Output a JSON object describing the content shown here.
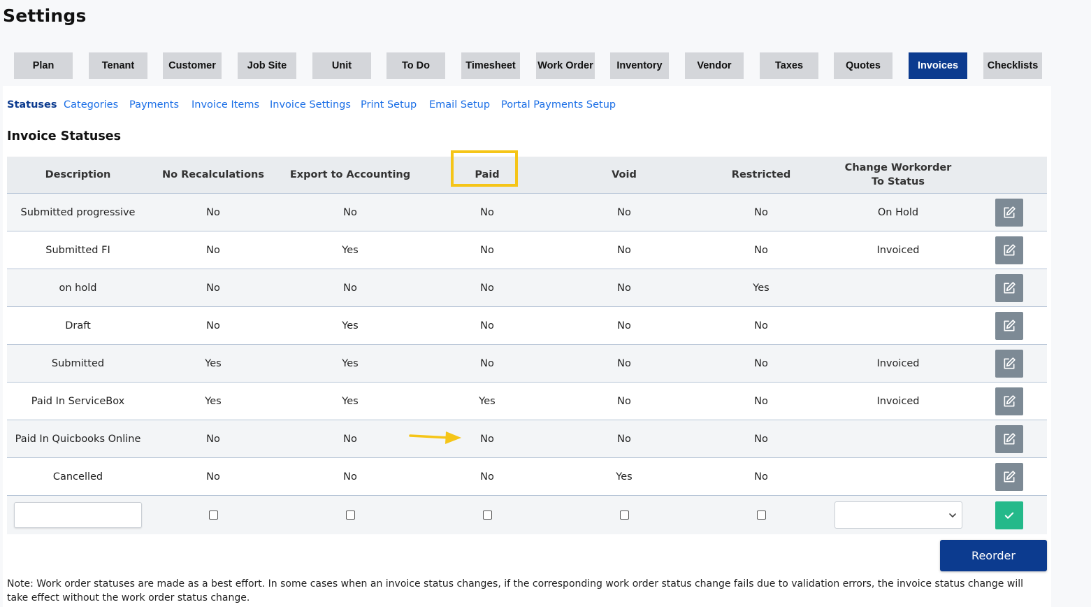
{
  "page": {
    "title": "Settings"
  },
  "top_tabs": [
    {
      "label": "Plan",
      "active": false
    },
    {
      "label": "Tenant",
      "active": false
    },
    {
      "label": "Customer",
      "active": false
    },
    {
      "label": "Job Site",
      "active": false
    },
    {
      "label": "Unit",
      "active": false
    },
    {
      "label": "To Do",
      "active": false
    },
    {
      "label": "Timesheet",
      "active": false
    },
    {
      "label": "Work Order",
      "active": false
    },
    {
      "label": "Inventory",
      "active": false
    },
    {
      "label": "Vendor",
      "active": false
    },
    {
      "label": "Taxes",
      "active": false
    },
    {
      "label": "Quotes",
      "active": false
    },
    {
      "label": "Invoices",
      "active": true
    },
    {
      "label": "Checklists",
      "active": false
    }
  ],
  "sub_tabs": [
    {
      "label": "Statuses",
      "active": true
    },
    {
      "label": "Categories",
      "active": false
    },
    {
      "label": "Payments",
      "active": false
    },
    {
      "label": "Invoice Items",
      "active": false
    },
    {
      "label": "Invoice Settings",
      "active": false
    },
    {
      "label": "Print Setup",
      "active": false
    },
    {
      "label": "Email Setup",
      "active": false
    },
    {
      "label": "Portal Payments Setup",
      "active": false
    }
  ],
  "section": {
    "title": "Invoice Statuses"
  },
  "table": {
    "headers": {
      "description": "Description",
      "no_recalculations": "No Recalculations",
      "export_to_accounting": "Export to Accounting",
      "paid": "Paid",
      "void": "Void",
      "restricted": "Restricted",
      "change_workorder_line1": "Change Workorder",
      "change_workorder_line2": "To Status"
    },
    "rows": [
      [
        "Submitted progressive",
        "No",
        "No",
        "No",
        "No",
        "No",
        "On Hold"
      ],
      [
        "Submitted FI",
        "No",
        "Yes",
        "No",
        "No",
        "No",
        "Invoiced"
      ],
      [
        "on hold",
        "No",
        "No",
        "No",
        "No",
        "Yes",
        ""
      ],
      [
        "Draft",
        "No",
        "Yes",
        "No",
        "No",
        "No",
        ""
      ],
      [
        "Submitted",
        "Yes",
        "Yes",
        "No",
        "No",
        "No",
        "Invoiced"
      ],
      [
        "Paid In ServiceBox",
        "Yes",
        "Yes",
        "Yes",
        "No",
        "No",
        "Invoiced"
      ],
      [
        "Paid In Quicbooks Online",
        "No",
        "No",
        "No",
        "No",
        "No",
        ""
      ],
      [
        "Cancelled",
        "No",
        "No",
        "No",
        "Yes",
        "No",
        ""
      ]
    ],
    "new_row": {
      "description_value": "",
      "no_recalculations": false,
      "export_to_accounting": false,
      "paid": false,
      "void": false,
      "restricted": false,
      "change_workorder_value": ""
    }
  },
  "buttons": {
    "reorder": "Reorder"
  },
  "note": "Note: Work order statuses are made as a best effort. In some cases when an invoice status changes, if the corresponding work order status change fails due to validation errors, the invoice status change will take effect without the work order status change.",
  "icons": {
    "edit": "edit-icon",
    "save": "checkmark-icon",
    "select": "chevron-down-icon"
  },
  "colors": {
    "active_tab": "#0c3b8f",
    "link": "#1a6ee6",
    "edit_button": "#7d8a95",
    "save_button": "#24b98a",
    "annotation": "#f5c518"
  }
}
